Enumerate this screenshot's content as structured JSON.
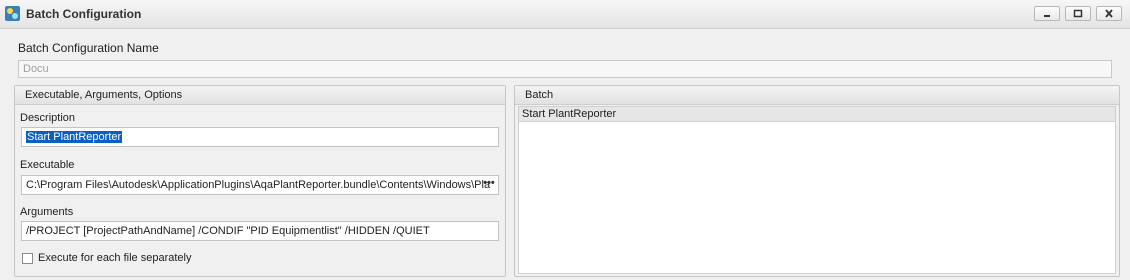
{
  "window": {
    "title": "Batch Configuration",
    "icon": "app-icon",
    "controls": [
      "minimize-icon",
      "maximize-icon",
      "close-icon"
    ]
  },
  "config_name": {
    "label": "Batch Configuration Name",
    "value": "Docu"
  },
  "left_panel": {
    "header": "Executable, Arguments, Options",
    "description_label": "Description",
    "description_value": "Start PlantReporter",
    "executable_label": "Executable",
    "executable_value": "C:\\Program Files\\Autodesk\\ApplicationPlugins\\AqaPlantReporter.bundle\\Contents\\Windows\\Pla",
    "browse_label": "•••",
    "arguments_label": "Arguments",
    "arguments_value": "/PROJECT [ProjectPathAndName] /CONDIF \"PID Equipmentlist\" /HIDDEN /QUIET",
    "checkbox_label": "Execute for each file separately",
    "checkbox_checked": false
  },
  "right_panel": {
    "header": "Batch",
    "items": [
      {
        "label": "Start PlantReporter"
      }
    ]
  },
  "colors": {
    "selection": "#0a5fc2",
    "background": "#f0f0f0"
  }
}
